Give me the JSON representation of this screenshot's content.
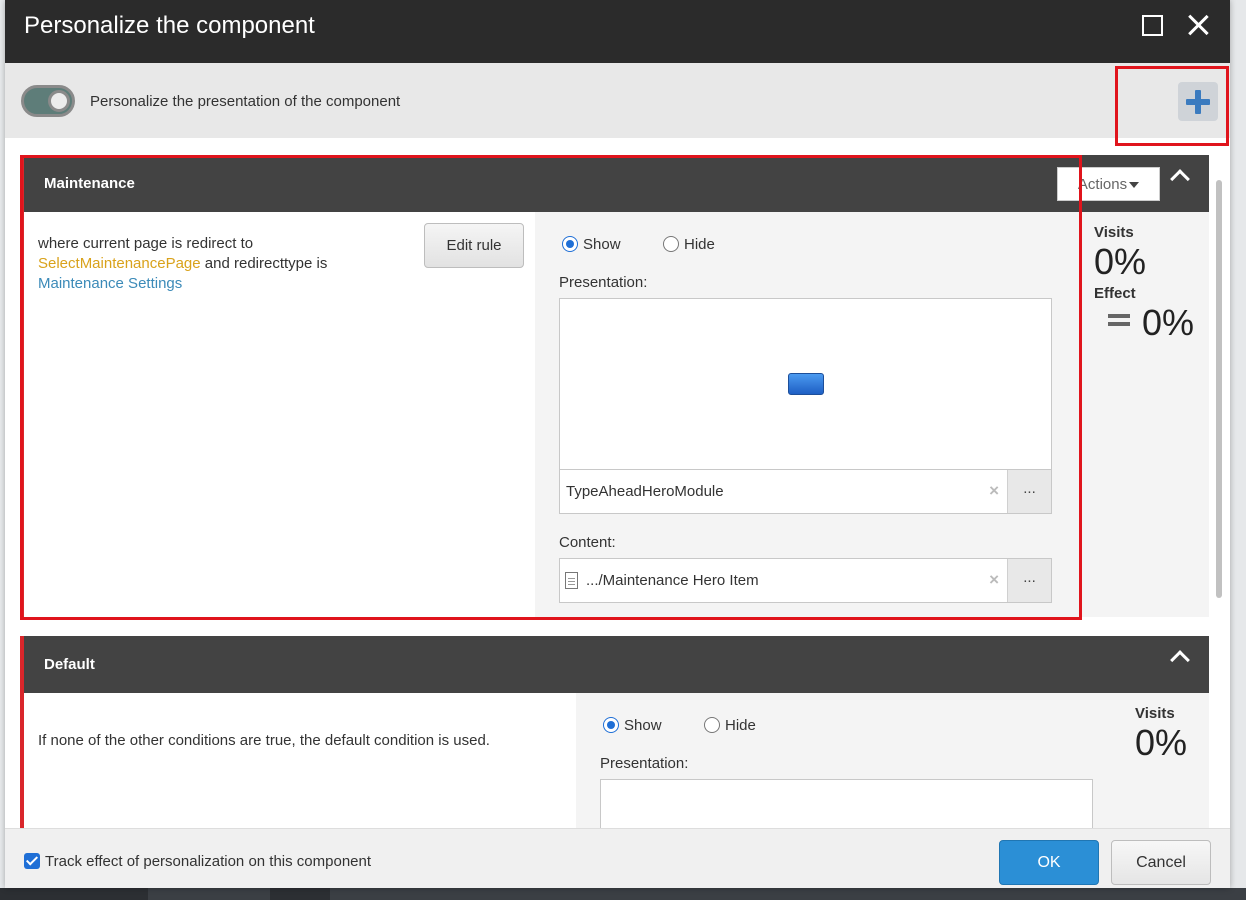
{
  "dialog": {
    "title": "Personalize the component",
    "maximize_icon": "maximize-icon",
    "close_icon": "close-icon"
  },
  "topbar": {
    "toggle_label": "Personalize the presentation of the component",
    "add_icon": "plus-icon"
  },
  "rules": [
    {
      "name": "Maintenance",
      "actions_label": "Actions",
      "condition": {
        "text_1": "where current page is redirect to",
        "macro_1": "SelectMaintenancePage",
        "text_2": " and redirecttype is",
        "macro_2": "Maintenance Settings"
      },
      "edit_rule_label": "Edit rule",
      "show_label": "Show",
      "hide_label": "Hide",
      "selected": "Show",
      "presentation_label": "Presentation:",
      "presentation_value": "TypeAheadHeroModule",
      "content_label": "Content:",
      "content_value": ".../Maintenance Hero Item",
      "browse_label": "...",
      "clear_label": "×",
      "visits_label": "Visits",
      "visits_value": "0%",
      "effect_label": "Effect",
      "effect_value": "0%"
    },
    {
      "name": "Default",
      "condition_text": "If none of the other conditions are true, the default condition is used.",
      "show_label": "Show",
      "hide_label": "Hide",
      "selected": "Show",
      "presentation_label": "Presentation:",
      "visits_label": "Visits",
      "visits_value": "0%"
    }
  ],
  "footer": {
    "track_label": "Track effect of personalization on this component",
    "track_checked": true,
    "ok_label": "OK",
    "cancel_label": "Cancel"
  },
  "colors": {
    "titlebar": "#2b2b2b",
    "rule_header": "#434343",
    "accent_red": "#d9262b",
    "ok_blue": "#2b8fd6",
    "highlight": "#e0141c"
  }
}
